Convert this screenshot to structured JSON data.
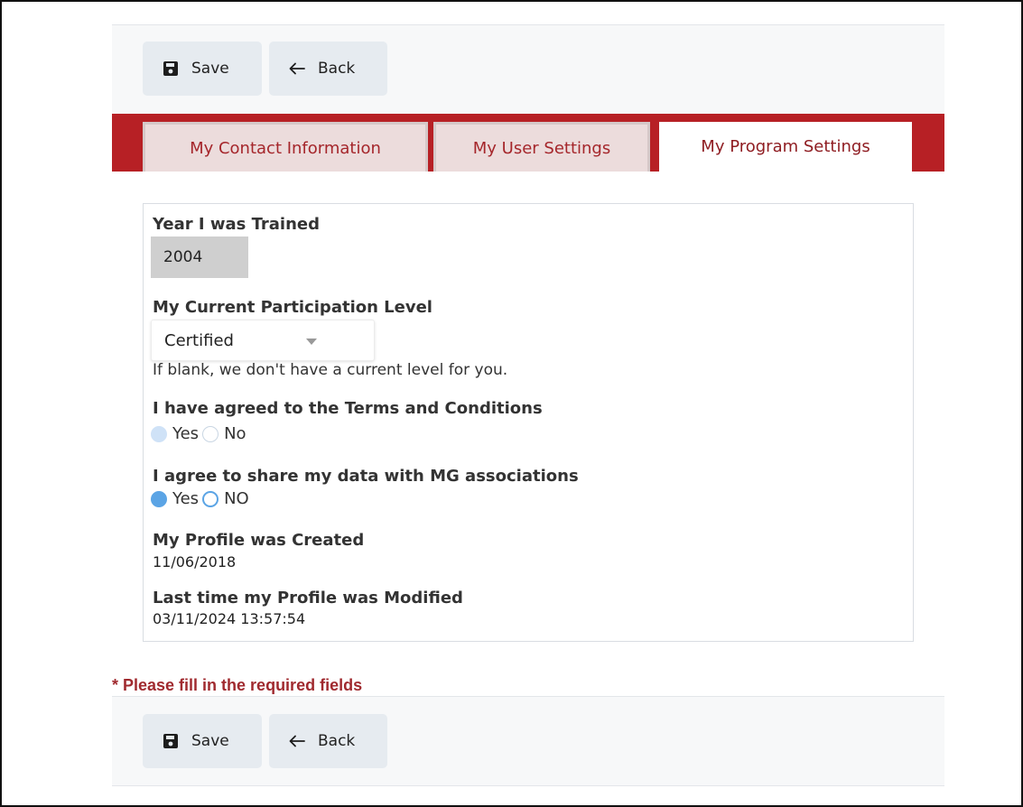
{
  "toolbar": {
    "save_label": "Save",
    "back_label": "Back"
  },
  "tabs": [
    {
      "label": "My Contact Information",
      "active": false
    },
    {
      "label": "My User Settings",
      "active": false
    },
    {
      "label": "My Program Settings",
      "active": true
    }
  ],
  "form": {
    "year_trained": {
      "label": "Year I was Trained",
      "value": "2004"
    },
    "participation": {
      "label": "My Current Participation Level",
      "selected": "Certified",
      "hint": "If blank, we don't have a current level for you."
    },
    "terms": {
      "label": "I have agreed to the Terms and Conditions",
      "options": [
        "Yes",
        "No"
      ]
    },
    "share_data": {
      "label": "I agree to share my data with MG associations",
      "options": [
        "Yes",
        "NO"
      ],
      "selected": "Yes"
    },
    "created": {
      "label": "My Profile was Created",
      "value": "11/06/2018"
    },
    "modified": {
      "label": "Last time my Profile was Modified",
      "value": "03/11/2024 13:57:54"
    }
  },
  "required_notice": "* Please fill in the required fields",
  "colors": {
    "brand_red": "#b72025",
    "tab_text": "#a5262b",
    "radio_selected": "#5ba4e5"
  },
  "icons": {
    "save": "floppy-disk-icon",
    "back": "arrow-left-icon"
  }
}
